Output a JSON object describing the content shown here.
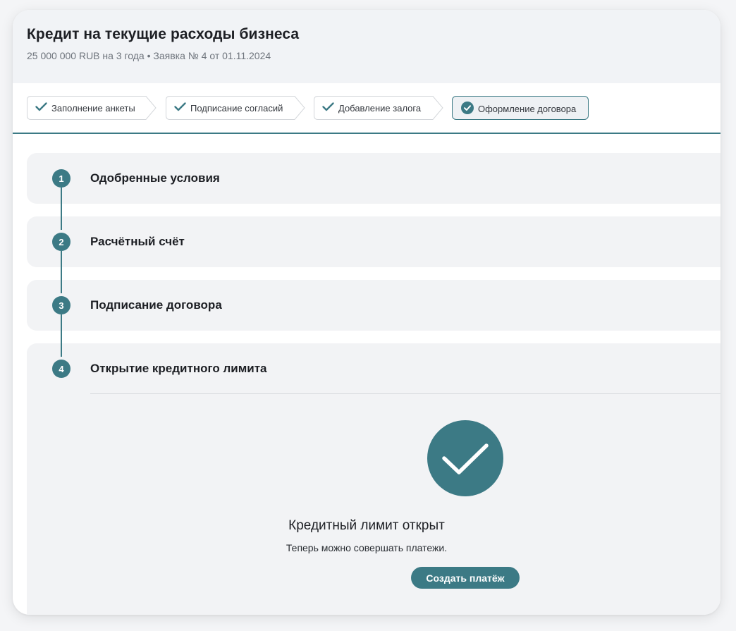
{
  "header": {
    "title": "Кредит на текущие расходы бизнеса",
    "subtitle": "25 000 000 RUB на 3 года • Заявка № 4 от 01.11.2024"
  },
  "progress_steps": [
    {
      "label": "Заполнение анкеты",
      "state": "done",
      "icon": "check-icon"
    },
    {
      "label": "Подписание согласий",
      "state": "done",
      "icon": "check-icon"
    },
    {
      "label": "Добавление залога",
      "state": "done",
      "icon": "check-icon"
    },
    {
      "label": "Оформление договора",
      "state": "active",
      "icon": "check-circle-icon"
    }
  ],
  "sections": [
    {
      "number": "1",
      "title": "Одобренные условия"
    },
    {
      "number": "2",
      "title": "Расчётный счёт"
    },
    {
      "number": "3",
      "title": "Подписание договора"
    },
    {
      "number": "4",
      "title": "Открытие кредитного лимита"
    }
  ],
  "success": {
    "icon": "check-icon",
    "title": "Кредитный лимит открыт",
    "message": "Теперь можно совершать платежи.",
    "button_label": "Создать платёж"
  },
  "colors": {
    "accent": "#3c7a85",
    "section_bg": "#f2f3f5",
    "header_bg": "#f1f3f6"
  }
}
